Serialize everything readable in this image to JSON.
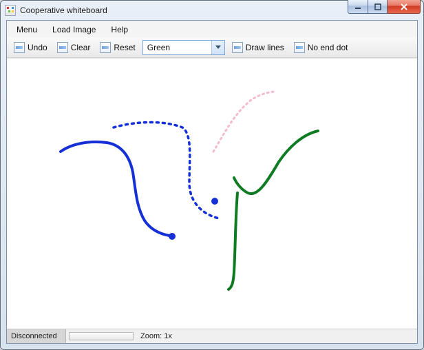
{
  "window": {
    "title": "Cooperative whiteboard"
  },
  "menubar": {
    "items": [
      {
        "label": "Menu"
      },
      {
        "label": "Load Image"
      },
      {
        "label": "Help"
      }
    ]
  },
  "toolbar": {
    "undo_label": "Undo",
    "clear_label": "Clear",
    "reset_label": "Reset",
    "color_select": {
      "value": "Green"
    },
    "drawlines_label": "Draw lines",
    "enddot_label": "No end dot"
  },
  "status": {
    "connection": "Disconnected",
    "zoom_label": "Zoom:  1x"
  },
  "colors": {
    "blue_stroke": "#1530d6",
    "green_stroke": "#0f7b22",
    "pink_stroke": "#f3bad0"
  }
}
